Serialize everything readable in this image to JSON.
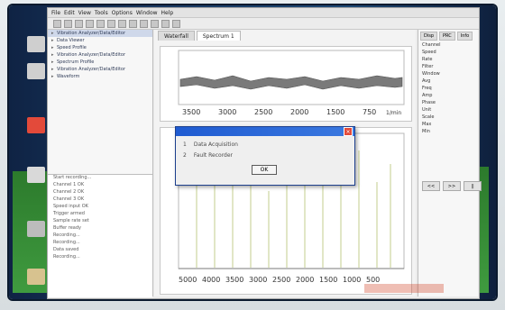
{
  "window": {
    "title": "",
    "menu": [
      "File",
      "Edit",
      "View",
      "Tools",
      "Options",
      "Window",
      "Help"
    ]
  },
  "left_panel": {
    "tree_items": [
      {
        "label": "Vibration Analyzer/Data/Editor",
        "selected": true
      },
      {
        "label": "Data Viewer",
        "selected": false
      },
      {
        "label": "Speed Profile",
        "selected": false
      },
      {
        "label": "Vibration Analyzer/Data/Editor",
        "selected": false
      },
      {
        "label": "Spectrum Profile",
        "selected": false
      },
      {
        "label": "Vibration Analyzer/Data/Editor",
        "selected": false
      },
      {
        "label": "Waveform",
        "selected": false
      }
    ],
    "log_rows": [
      "Start recording...",
      "Channel 1 OK",
      "Channel 2 OK",
      "Channel 3 OK",
      "Speed input OK",
      "Trigger armed",
      "Sample rate set",
      "Buffer ready",
      "Recording...",
      "Recording...",
      "Data saved",
      "Recording..."
    ]
  },
  "center": {
    "tabs": [
      {
        "label": "Waterfall",
        "active": false
      },
      {
        "label": "Spectrum 1",
        "active": true
      }
    ],
    "top_chart": {
      "x_ticks": [
        "3500",
        "3000",
        "2500",
        "2000",
        "1500",
        "750"
      ],
      "unit": "1/min"
    },
    "bottom_chart": {
      "x_ticks": [
        "5000",
        "4000",
        "3500",
        "3000",
        "2500",
        "2000",
        "1500",
        "1000",
        "500"
      ],
      "unit": ""
    }
  },
  "right_panel": {
    "tabs": [
      "Disp",
      "PRC",
      "Info"
    ],
    "rows": [
      "Channel",
      "Speed",
      "Rate",
      "Filter",
      "Window",
      "Avg",
      "Freq",
      "Amp",
      "Phase",
      "Unit",
      "Scale",
      "Max",
      "Min"
    ],
    "buttons": [
      "<<",
      ">>",
      "||"
    ]
  },
  "dialog": {
    "title": "",
    "rows": [
      {
        "num": "1",
        "text": "Data Acquisition"
      },
      {
        "num": "2",
        "text": "Fault Recorder"
      }
    ],
    "ok_label": "OK"
  },
  "bottom_note": "",
  "chart_data": [
    {
      "type": "line",
      "title": "",
      "xlabel": "",
      "ylabel": "",
      "x_ticks": [
        "3500",
        "3000",
        "2500",
        "2000",
        "1500",
        "750"
      ],
      "series": [
        {
          "values": []
        }
      ]
    },
    {
      "type": "line",
      "title": "",
      "xlabel": "",
      "ylabel": "",
      "x_ticks": [
        "5000",
        "4000",
        "3500",
        "3000",
        "2500",
        "2000",
        "1500",
        "1000",
        "500"
      ],
      "series": [
        {
          "values": []
        }
      ]
    }
  ]
}
